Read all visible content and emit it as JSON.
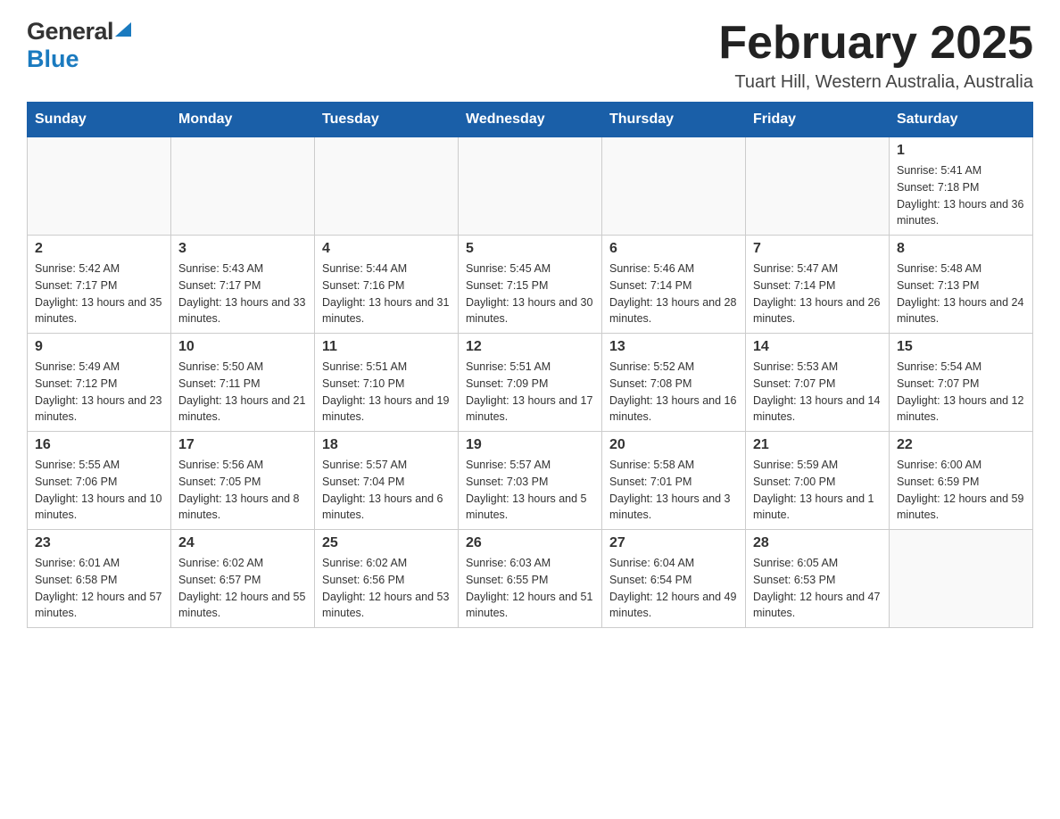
{
  "header": {
    "logo_general": "General",
    "logo_blue": "Blue",
    "title": "February 2025",
    "subtitle": "Tuart Hill, Western Australia, Australia"
  },
  "weekdays": [
    "Sunday",
    "Monday",
    "Tuesday",
    "Wednesday",
    "Thursday",
    "Friday",
    "Saturday"
  ],
  "weeks": [
    [
      {
        "day": "",
        "info": ""
      },
      {
        "day": "",
        "info": ""
      },
      {
        "day": "",
        "info": ""
      },
      {
        "day": "",
        "info": ""
      },
      {
        "day": "",
        "info": ""
      },
      {
        "day": "",
        "info": ""
      },
      {
        "day": "1",
        "info": "Sunrise: 5:41 AM\nSunset: 7:18 PM\nDaylight: 13 hours and 36 minutes."
      }
    ],
    [
      {
        "day": "2",
        "info": "Sunrise: 5:42 AM\nSunset: 7:17 PM\nDaylight: 13 hours and 35 minutes."
      },
      {
        "day": "3",
        "info": "Sunrise: 5:43 AM\nSunset: 7:17 PM\nDaylight: 13 hours and 33 minutes."
      },
      {
        "day": "4",
        "info": "Sunrise: 5:44 AM\nSunset: 7:16 PM\nDaylight: 13 hours and 31 minutes."
      },
      {
        "day": "5",
        "info": "Sunrise: 5:45 AM\nSunset: 7:15 PM\nDaylight: 13 hours and 30 minutes."
      },
      {
        "day": "6",
        "info": "Sunrise: 5:46 AM\nSunset: 7:14 PM\nDaylight: 13 hours and 28 minutes."
      },
      {
        "day": "7",
        "info": "Sunrise: 5:47 AM\nSunset: 7:14 PM\nDaylight: 13 hours and 26 minutes."
      },
      {
        "day": "8",
        "info": "Sunrise: 5:48 AM\nSunset: 7:13 PM\nDaylight: 13 hours and 24 minutes."
      }
    ],
    [
      {
        "day": "9",
        "info": "Sunrise: 5:49 AM\nSunset: 7:12 PM\nDaylight: 13 hours and 23 minutes."
      },
      {
        "day": "10",
        "info": "Sunrise: 5:50 AM\nSunset: 7:11 PM\nDaylight: 13 hours and 21 minutes."
      },
      {
        "day": "11",
        "info": "Sunrise: 5:51 AM\nSunset: 7:10 PM\nDaylight: 13 hours and 19 minutes."
      },
      {
        "day": "12",
        "info": "Sunrise: 5:51 AM\nSunset: 7:09 PM\nDaylight: 13 hours and 17 minutes."
      },
      {
        "day": "13",
        "info": "Sunrise: 5:52 AM\nSunset: 7:08 PM\nDaylight: 13 hours and 16 minutes."
      },
      {
        "day": "14",
        "info": "Sunrise: 5:53 AM\nSunset: 7:07 PM\nDaylight: 13 hours and 14 minutes."
      },
      {
        "day": "15",
        "info": "Sunrise: 5:54 AM\nSunset: 7:07 PM\nDaylight: 13 hours and 12 minutes."
      }
    ],
    [
      {
        "day": "16",
        "info": "Sunrise: 5:55 AM\nSunset: 7:06 PM\nDaylight: 13 hours and 10 minutes."
      },
      {
        "day": "17",
        "info": "Sunrise: 5:56 AM\nSunset: 7:05 PM\nDaylight: 13 hours and 8 minutes."
      },
      {
        "day": "18",
        "info": "Sunrise: 5:57 AM\nSunset: 7:04 PM\nDaylight: 13 hours and 6 minutes."
      },
      {
        "day": "19",
        "info": "Sunrise: 5:57 AM\nSunset: 7:03 PM\nDaylight: 13 hours and 5 minutes."
      },
      {
        "day": "20",
        "info": "Sunrise: 5:58 AM\nSunset: 7:01 PM\nDaylight: 13 hours and 3 minutes."
      },
      {
        "day": "21",
        "info": "Sunrise: 5:59 AM\nSunset: 7:00 PM\nDaylight: 13 hours and 1 minute."
      },
      {
        "day": "22",
        "info": "Sunrise: 6:00 AM\nSunset: 6:59 PM\nDaylight: 12 hours and 59 minutes."
      }
    ],
    [
      {
        "day": "23",
        "info": "Sunrise: 6:01 AM\nSunset: 6:58 PM\nDaylight: 12 hours and 57 minutes."
      },
      {
        "day": "24",
        "info": "Sunrise: 6:02 AM\nSunset: 6:57 PM\nDaylight: 12 hours and 55 minutes."
      },
      {
        "day": "25",
        "info": "Sunrise: 6:02 AM\nSunset: 6:56 PM\nDaylight: 12 hours and 53 minutes."
      },
      {
        "day": "26",
        "info": "Sunrise: 6:03 AM\nSunset: 6:55 PM\nDaylight: 12 hours and 51 minutes."
      },
      {
        "day": "27",
        "info": "Sunrise: 6:04 AM\nSunset: 6:54 PM\nDaylight: 12 hours and 49 minutes."
      },
      {
        "day": "28",
        "info": "Sunrise: 6:05 AM\nSunset: 6:53 PM\nDaylight: 12 hours and 47 minutes."
      },
      {
        "day": "",
        "info": ""
      }
    ]
  ]
}
